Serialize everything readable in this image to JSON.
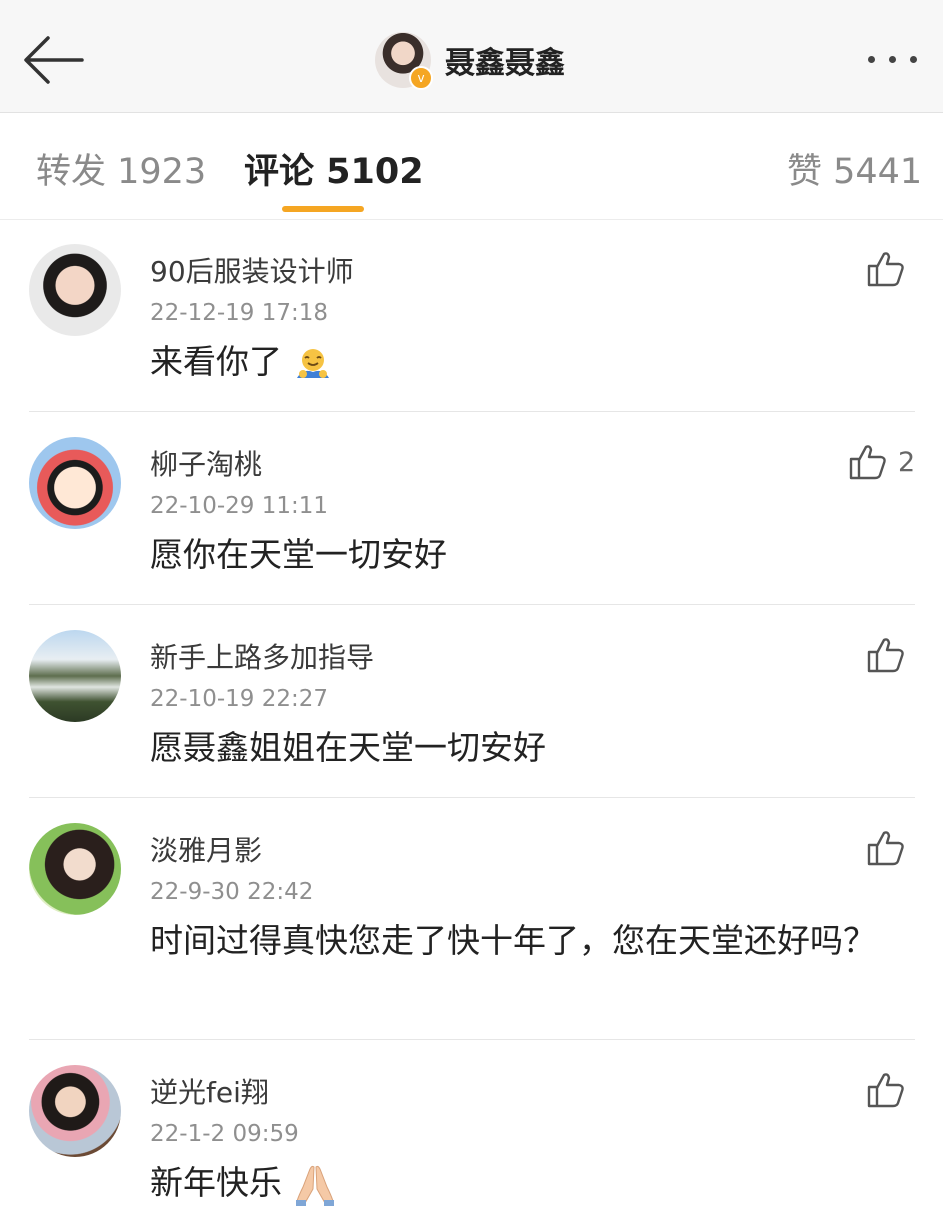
{
  "header": {
    "title": "聂鑫聂鑫",
    "verified_mark": "v",
    "back_icon": "back-arrow-icon",
    "more_icon": "more-dots-icon"
  },
  "tabs": {
    "repost": "转发 1923",
    "comments": "评论 5102",
    "likes": "赞 5441",
    "active_color": "#f5a623"
  },
  "comments": [
    {
      "user": "90后服装设计师",
      "time": "22-12-19 17:18",
      "text": "来看你了",
      "emoji": "hug-emoji",
      "likes": ""
    },
    {
      "user": "柳子淘桃",
      "time": "22-10-29 11:11",
      "text": "愿你在天堂一切安好",
      "likes": "2"
    },
    {
      "user": "新手上路多加指导",
      "time": "22-10-19 22:27",
      "text": "愿聂鑫姐姐在天堂一切安好",
      "likes": ""
    },
    {
      "user": "淡雅月影",
      "time": "22-9-30 22:42",
      "text": "时间过得真快您走了快十年了，您在天堂还好吗？",
      "likes": ""
    },
    {
      "user": "逆光fei翔",
      "time": "22-1-2 09:59",
      "text": "新年快乐",
      "emoji": "praying-hands-emoji",
      "likes": ""
    }
  ]
}
